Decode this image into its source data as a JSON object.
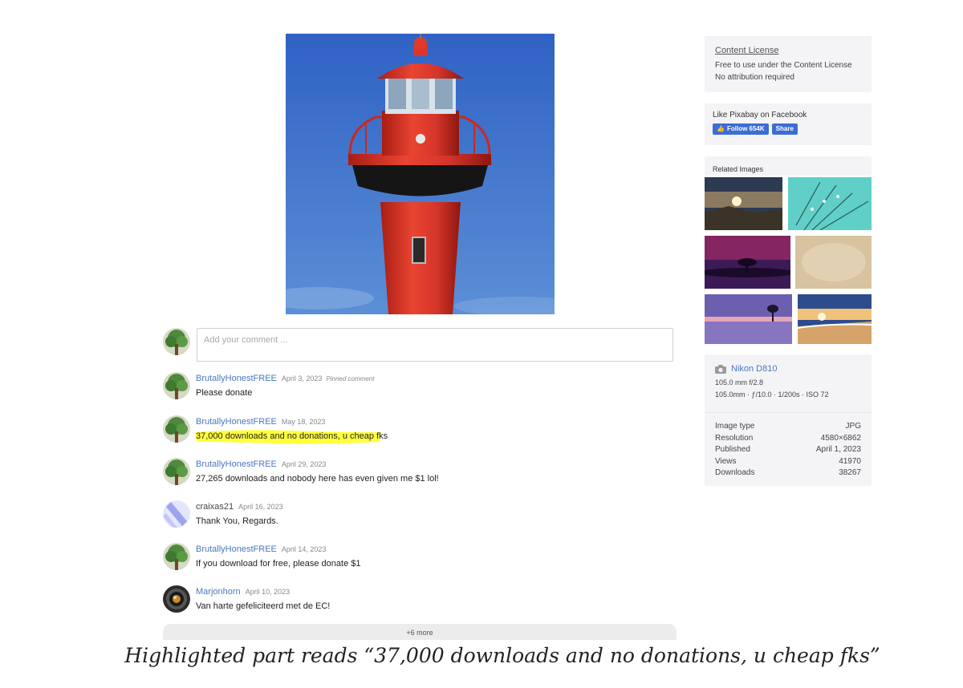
{
  "composer": {
    "placeholder": "Add your comment ..."
  },
  "comments": [
    {
      "user": "BrutallyHonestFREE",
      "date": "April 3, 2023",
      "pinned": "Pinned comment",
      "text": "Please donate",
      "avatar": "tree-avatar"
    },
    {
      "user": "BrutallyHonestFREE",
      "date": "May 18, 2023",
      "text": "37,000 downloads and no donations, u cheap fks",
      "avatar": "tree-avatar",
      "highlighted": true,
      "highlight_color": "#ffff33"
    },
    {
      "user": "BrutallyHonestFREE",
      "date": "April 29, 2023",
      "text": "27,265 downloads and nobody here has even given me $1 lol!",
      "avatar": "tree-avatar"
    },
    {
      "user": "craixas21",
      "date": "April 16, 2023",
      "text": "Thank You, Regards.",
      "avatar": "stripe-avatar"
    },
    {
      "user": "BrutallyHonestFREE",
      "date": "April 14, 2023",
      "text": "If you download for free, please donate $1",
      "avatar": "tree-avatar"
    },
    {
      "user": "Marjonhorn",
      "date": "April 10, 2023",
      "text": "Van harte gefeliciteerd met de EC!",
      "avatar": "lens-avatar"
    }
  ],
  "more_label": "+6 more",
  "sidebar": {
    "license": {
      "title": "Content License",
      "line1": "Free to use under the Content License",
      "line2": "No attribution required"
    },
    "facebook": {
      "label": "Like Pixabay on Facebook",
      "follow_label": "Follow 654K",
      "share_label": "Share"
    },
    "related_title": "Related Images",
    "camera": {
      "name": "Nikon D810",
      "lens": "105.0 mm f/2.8",
      "settings": "105.0mm · ƒ/10.0 · 1/200s · ISO 72",
      "icon": "camera-icon"
    },
    "specs": [
      {
        "label": "Image type",
        "value": "JPG"
      },
      {
        "label": "Resolution",
        "value": "4580×6862"
      },
      {
        "label": "Published",
        "value": "April 1, 2023"
      },
      {
        "label": "Views",
        "value": "41970"
      },
      {
        "label": "Downloads",
        "value": "38267"
      }
    ]
  },
  "caption": "Highlighted part reads “37,000 downloads and no donations, u cheap fks”",
  "colors": {
    "link": "#4b77be",
    "sidebar_bg": "#f4f4f7",
    "facebook": "#3b6dd6",
    "highlight": "#ffff33",
    "lighthouse_red": "#e03a2a",
    "sky": "#3a72c8"
  }
}
